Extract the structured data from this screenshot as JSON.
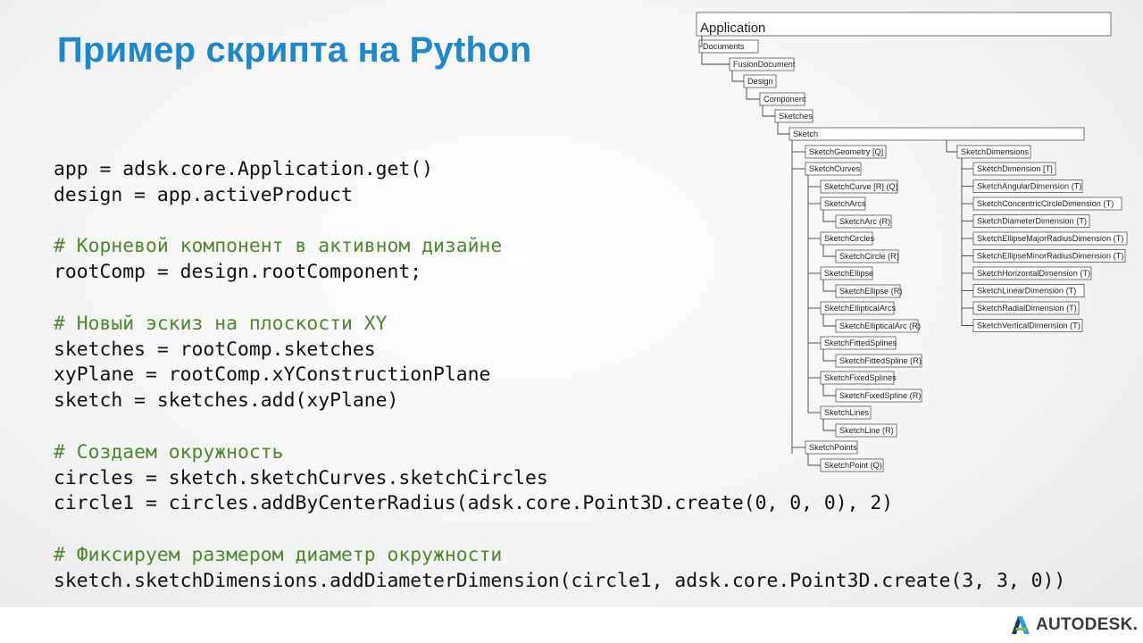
{
  "slide": {
    "title": "Пример скрипта на Python"
  },
  "code_lines": [
    {
      "text": "app = adsk.core.Application.get()",
      "kind": "code"
    },
    {
      "text": "design = app.activeProduct",
      "kind": "code"
    },
    {
      "text": "",
      "kind": "blank"
    },
    {
      "text": "# Корневой компонент в активном дизайне",
      "kind": "comment"
    },
    {
      "text": "rootComp = design.rootComponent;",
      "kind": "code"
    },
    {
      "text": "",
      "kind": "blank"
    },
    {
      "text": "# Новый эскиз на плоскости XY",
      "kind": "comment"
    },
    {
      "text": "sketches = rootComp.sketches",
      "kind": "code"
    },
    {
      "text": "xyPlane = rootComp.xYConstructionPlane",
      "kind": "code"
    },
    {
      "text": "sketch = sketches.add(xyPlane)",
      "kind": "code"
    },
    {
      "text": "",
      "kind": "blank"
    },
    {
      "text": "# Создаем окружность",
      "kind": "comment"
    },
    {
      "text": "circles = sketch.sketchCurves.sketchCircles",
      "kind": "code"
    },
    {
      "text": "circle1 = circles.addByCenterRadius(adsk.core.Point3D.create(0, 0, 0), 2)",
      "kind": "code"
    },
    {
      "text": "",
      "kind": "blank"
    },
    {
      "text": "# Фиксируем размером диаметр окружности",
      "kind": "comment"
    },
    {
      "text": "sketch.sketchDimensions.addDiameterDimension(circle1, adsk.core.Point3D.create(3, 3, 0))",
      "kind": "code"
    }
  ],
  "object_model": {
    "root": "Application",
    "chain": [
      "Documents",
      "FusionDocument",
      "Design",
      "Component",
      "Sketches",
      "Sketch"
    ],
    "sketch_children": {
      "geometry": "SketchGeometry [Q]",
      "curves": "SketchCurves",
      "curve_items": [
        "SketchCurve [R] (Q)",
        "SketchArcs",
        "SketchArc (R)",
        "SketchCircles",
        "SketchCircle (R)",
        "SketchEllipse",
        "SketchEllipse (R)",
        "SketchEllipticalArcs",
        "SketchEllipticalArc (R)",
        "SketchFittedSplines",
        "SketchFittedSpline (R)",
        "SketchFixedSplines",
        "SketchFixedSpline (R)",
        "SketchLines",
        "SketchLine (R)"
      ],
      "points": "SketchPoints",
      "point_item": "SketchPoint (Q)",
      "dimensions": "SketchDimensions",
      "dimension_items": [
        "SketchDimension [T]",
        "SketchAngularDimension (T)",
        "SketchConcentricCircleDimension (T)",
        "SketchDiameterDimension (T)",
        "SketchEllipseMajorRadiusDimension (T)",
        "SketchEllipseMinorRadiusDimension (T)",
        "SketchHorizontalDimension (T)",
        "SketchLinearDimension (T)",
        "SketchRadialDimension (T)",
        "SketchVerticalDimension (T)"
      ]
    }
  },
  "brand": {
    "logo_text": "AUTODESK.",
    "accent_color": "#1e88c8",
    "comment_color": "#4c8a2c",
    "logo_icon": "autodesk-a-icon"
  }
}
